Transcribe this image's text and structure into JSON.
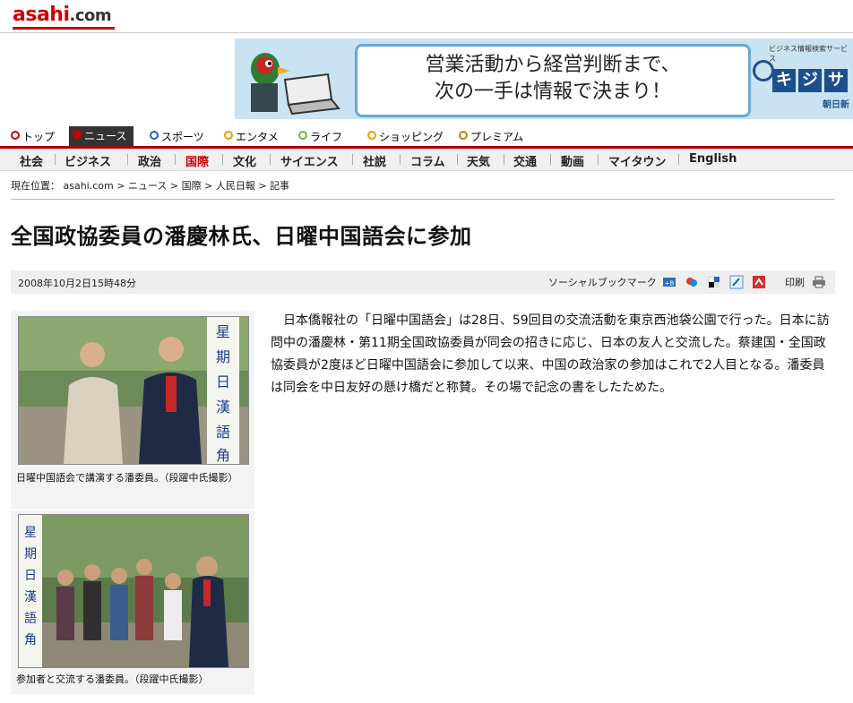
{
  "header": {
    "logo_main": "asahi",
    "logo_com": ".com"
  },
  "banner": {
    "line1": "営業活動から経営判断まで、",
    "line2": "次の一手は情報で決まり！",
    "brand_small": "ビジネス情報検索サービス",
    "brand_chars": [
      "キ",
      "ジ",
      "サ"
    ],
    "brand_sub": "朝日新"
  },
  "nav_primary": [
    {
      "label": "トップ"
    },
    {
      "label": "ニュース",
      "active": true
    },
    {
      "label": "スポーツ"
    },
    {
      "label": "エンタメ"
    },
    {
      "label": "ライフ"
    },
    {
      "label": "ショッピング"
    },
    {
      "label": "プレミアム"
    }
  ],
  "nav_secondary": [
    {
      "label": "社会"
    },
    {
      "label": "ビジネス"
    },
    {
      "label": "政治"
    },
    {
      "label": "国際",
      "current": true
    },
    {
      "label": "文化"
    },
    {
      "label": "サイエンス"
    },
    {
      "label": "社説"
    },
    {
      "label": "コラム"
    },
    {
      "label": "天気"
    },
    {
      "label": "交通"
    },
    {
      "label": "動画"
    },
    {
      "label": "マイタウン"
    },
    {
      "label": "English"
    }
  ],
  "breadcrumb": {
    "label": "現在位置：",
    "items": [
      "asahi.com",
      "ニュース",
      "国際",
      "人民日報",
      "記事"
    ],
    "sep": " > "
  },
  "article": {
    "title": "全国政協委員の潘慶林氏、日曜中国語会に参加",
    "date": "2008年10月2日15時48分",
    "social_label": "ソーシャルブックマーク",
    "print_label": "印刷",
    "body": "日本僑報社の「日曜中国語会」は28日、59回目の交流活動を東京西池袋公園で行った。日本に訪問中の潘慶林・第11期全国政協委員が同会の招きに応じ、日本の友人と交流した。蔡建国・全国政協委員が2度ほど日曜中国語会に参加して以来、中国の政治家の参加はこれで2人目となる。潘委員は同会を中日友好の懸け橋だと称賛。その場で記念の書をしたためた。",
    "figures": [
      {
        "caption": "日曜中国語会で講演する潘委員。（段躍中氏撮影）",
        "banner_text": "星期日漢語角"
      },
      {
        "caption": "参加者と交流する潘委員。（段躍中氏撮影）",
        "banner_text": "星期日漢語角"
      }
    ]
  },
  "colors": {
    "brand_red": "#cc0000",
    "nav_dark": "#333333",
    "banner_blue": "#c9e3f2"
  }
}
